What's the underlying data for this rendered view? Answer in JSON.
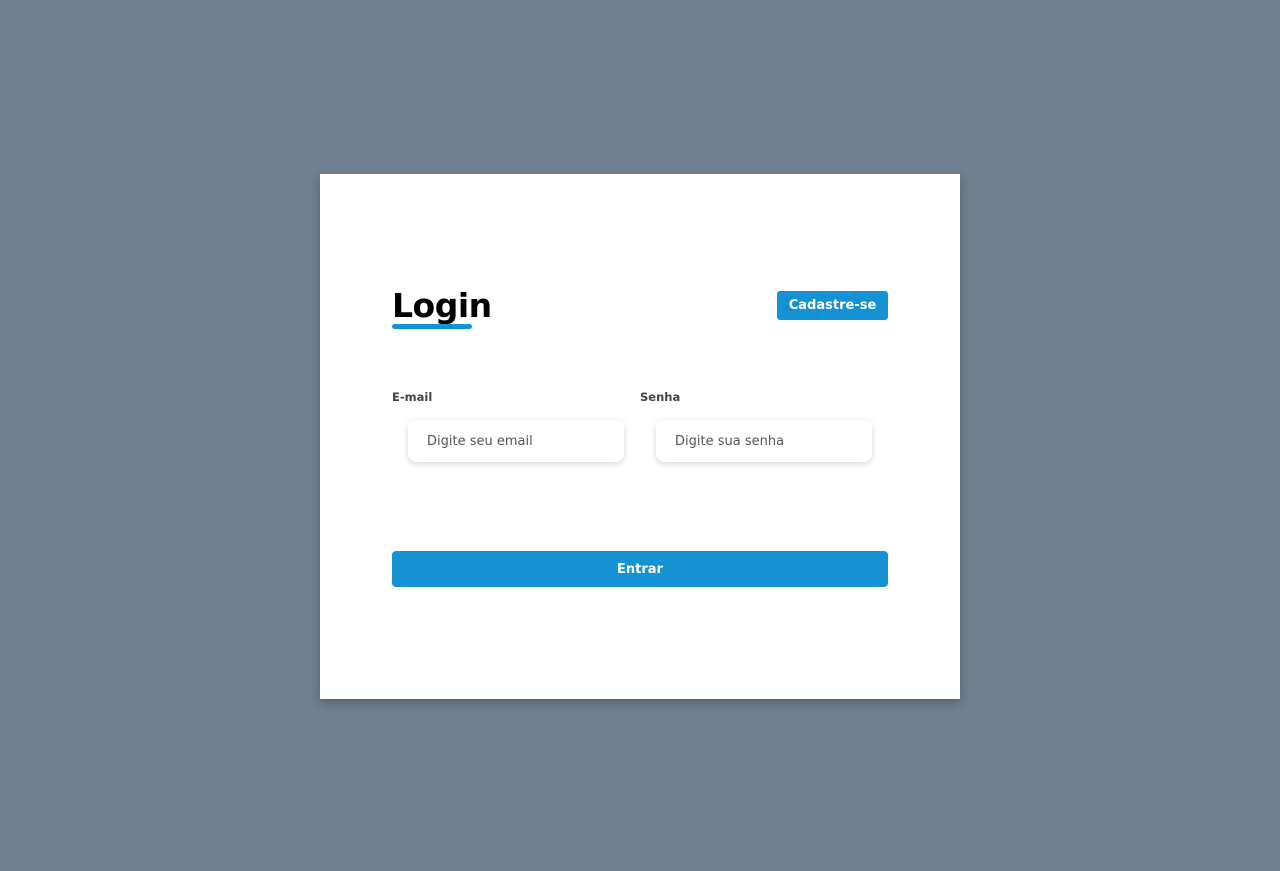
{
  "login": {
    "title": "Login",
    "signup_label": "Cadastre-se",
    "email": {
      "label": "E-mail",
      "placeholder": "Digite seu email",
      "value": ""
    },
    "password": {
      "label": "Senha",
      "placeholder": "Digite sua senha",
      "value": ""
    },
    "submit_label": "Entrar"
  },
  "colors": {
    "background": "#708090",
    "accent": "#1592d4",
    "card": "#ffffff"
  }
}
